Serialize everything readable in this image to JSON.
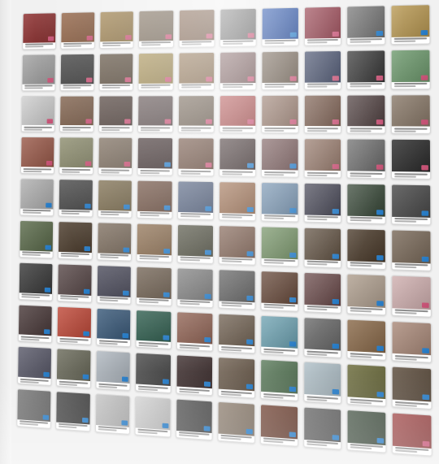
{
  "gallery": {
    "columns": 10,
    "rows": 10,
    "items": [
      {
        "color": "#8b2b2b",
        "badge": "pink"
      },
      {
        "color": "#8c5a3a",
        "badge": "pink"
      },
      {
        "color": "#9a7b44",
        "badge": "pink"
      },
      {
        "color": "#7b6b58",
        "badge": "pink"
      },
      {
        "color": "#7a5a43",
        "badge": "pink"
      },
      {
        "color": "#6f6f6f",
        "badge": "pink"
      },
      {
        "color": "#1c4aa8",
        "badge": "blue"
      },
      {
        "color": "#8b2b3a",
        "badge": "pink"
      },
      {
        "color": "#6d6d6d",
        "badge": "blue"
      },
      {
        "color": "#b99953",
        "badge": "blue"
      },
      {
        "color": "#a2a2a2",
        "badge": "pink"
      },
      {
        "color": "#3b3b3b",
        "badge": "pink"
      },
      {
        "color": "#5a4b3a",
        "badge": "pink"
      },
      {
        "color": "#a28a4a",
        "badge": "pink"
      },
      {
        "color": "#8a6b48",
        "badge": "pink"
      },
      {
        "color": "#7a5a5a",
        "badge": "pink"
      },
      {
        "color": "#6a5a4a",
        "badge": "pink"
      },
      {
        "color": "#2f3a5a",
        "badge": "pink"
      },
      {
        "color": "#2b2b2b",
        "badge": "pink"
      },
      {
        "color": "#6e9a6e",
        "badge": "pink"
      },
      {
        "color": "#cfcfcf",
        "badge": "pink"
      },
      {
        "color": "#7a5a44",
        "badge": "pink"
      },
      {
        "color": "#4b3b35",
        "badge": "pink"
      },
      {
        "color": "#5a4b4b",
        "badge": "pink"
      },
      {
        "color": "#6b5b4b",
        "badge": "pink"
      },
      {
        "color": "#b04a4a",
        "badge": "pink"
      },
      {
        "color": "#8a6a5a",
        "badge": "pink"
      },
      {
        "color": "#6b4a3a",
        "badge": "pink"
      },
      {
        "color": "#4a3a3a",
        "badge": "pink"
      },
      {
        "color": "#8a7a6a",
        "badge": "pink"
      },
      {
        "color": "#9a5a4a",
        "badge": "pink"
      },
      {
        "color": "#8a8a6a",
        "badge": "pink"
      },
      {
        "color": "#7a6a5a",
        "badge": "pink"
      },
      {
        "color": "#3a2a2a",
        "badge": "blue"
      },
      {
        "color": "#6a4a3a",
        "badge": "pink"
      },
      {
        "color": "#3b2b2b",
        "badge": "blue"
      },
      {
        "color": "#6b4a4a",
        "badge": "blue"
      },
      {
        "color": "#8a6a5a",
        "badge": "pink"
      },
      {
        "color": "#6a6a6a",
        "badge": "pink"
      },
      {
        "color": "#2b2b2b",
        "badge": "pink"
      },
      {
        "color": "#b0b0b0",
        "badge": "blue"
      },
      {
        "color": "#4a4a4a",
        "badge": "blue"
      },
      {
        "color": "#7a6a4a",
        "badge": "blue"
      },
      {
        "color": "#6a4a3a",
        "badge": "blue"
      },
      {
        "color": "#4a5a7a",
        "badge": "blue"
      },
      {
        "color": "#9a6a4a",
        "badge": "blue"
      },
      {
        "color": "#6a8aaa",
        "badge": "blue"
      },
      {
        "color": "#3a3a4a",
        "badge": "blue"
      },
      {
        "color": "#3a4a3a",
        "badge": "blue"
      },
      {
        "color": "#4a4a4a",
        "badge": "blue"
      },
      {
        "color": "#5a6a4a",
        "badge": "blue"
      },
      {
        "color": "#4a3a2a",
        "badge": "blue"
      },
      {
        "color": "#7a6a5a",
        "badge": "blue"
      },
      {
        "color": "#8a6a4a",
        "badge": "blue"
      },
      {
        "color": "#4a4a3a",
        "badge": "blue"
      },
      {
        "color": "#7a5a4a",
        "badge": "blue"
      },
      {
        "color": "#6a8a5a",
        "badge": "blue"
      },
      {
        "color": "#5a4a3a",
        "badge": "blue"
      },
      {
        "color": "#4a3a2a",
        "badge": "blue"
      },
      {
        "color": "#7a6a5a",
        "badge": "blue"
      },
      {
        "color": "#3a3a3a",
        "badge": "blue"
      },
      {
        "color": "#5a4a4a",
        "badge": "blue"
      },
      {
        "color": "#4a4a5a",
        "badge": "blue"
      },
      {
        "color": "#6a5a4a",
        "badge": "blue"
      },
      {
        "color": "#7a7a7a",
        "badge": "blue"
      },
      {
        "color": "#5a5a5a",
        "badge": "blue"
      },
      {
        "color": "#5a3a2a",
        "badge": "blue"
      },
      {
        "color": "#6a4a4a",
        "badge": "blue"
      },
      {
        "color": "#b0a090",
        "badge": "blue"
      },
      {
        "color": "#d0b0b0",
        "badge": "pink"
      },
      {
        "color": "#4a3a3a",
        "badge": "blue"
      },
      {
        "color": "#c04a3a",
        "badge": "blue"
      },
      {
        "color": "#3a5a7a",
        "badge": "blue"
      },
      {
        "color": "#2a5a4a",
        "badge": "blue"
      },
      {
        "color": "#8a5a4a",
        "badge": "blue"
      },
      {
        "color": "#6a5a4a",
        "badge": "blue"
      },
      {
        "color": "#6aa0b0",
        "badge": "blue"
      },
      {
        "color": "#6a6a6a",
        "badge": "blue"
      },
      {
        "color": "#8a6a4a",
        "badge": "blue"
      },
      {
        "color": "#aa8a7a",
        "badge": "blue"
      },
      {
        "color": "#5a5a6a",
        "badge": "blue"
      },
      {
        "color": "#6a6a5a",
        "badge": "blue"
      },
      {
        "color": "#b0b8c0",
        "badge": "blue"
      },
      {
        "color": "#4a4a4a",
        "badge": "blue"
      },
      {
        "color": "#3a2a2a",
        "badge": "blue"
      },
      {
        "color": "#6a5a4a",
        "badge": "blue"
      },
      {
        "color": "#5a7a5a",
        "badge": "blue"
      },
      {
        "color": "#b0c0c8",
        "badge": "blue"
      },
      {
        "color": "#6a6a3a",
        "badge": "blue"
      },
      {
        "color": "#5a4a3a",
        "badge": "blue"
      },
      {
        "color": "#6a6a6a",
        "badge": "blue"
      },
      {
        "color": "#3a3a3a",
        "badge": "blue"
      },
      {
        "color": "#c0c0c0",
        "badge": "blue"
      },
      {
        "color": "#d0d0d0",
        "badge": "blue"
      },
      {
        "color": "#4a4a4a",
        "badge": "blue"
      },
      {
        "color": "#8a7a6a",
        "badge": "blue"
      },
      {
        "color": "#6a3a2a",
        "badge": "blue"
      },
      {
        "color": "#5a5a5a",
        "badge": "blue"
      },
      {
        "color": "#3a4a3a",
        "badge": "blue"
      },
      {
        "color": "#9a3a3a",
        "badge": "pink"
      }
    ]
  },
  "colors": {
    "badge_pink": "#e85c86",
    "badge_blue": "#2a8fe8",
    "background": "#f1f1f1"
  }
}
